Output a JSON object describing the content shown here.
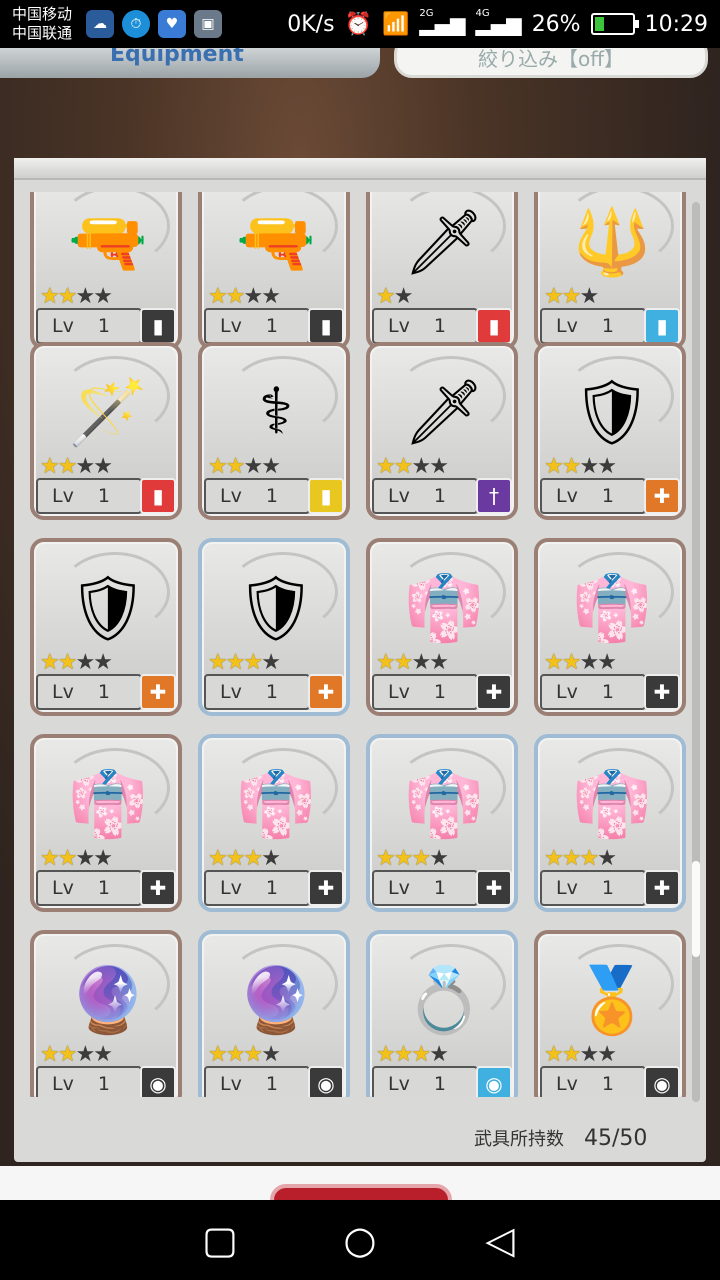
{
  "statusbar": {
    "carrier1": "中国移动",
    "carrier2": "中国联通",
    "net_speed": "0K/s",
    "net2g": "2G",
    "net4g": "4G",
    "battery": "26%",
    "time": "10:29",
    "battery_level": 0.26
  },
  "header": {
    "title": "Equipment",
    "filter_label": "絞り込み【off】"
  },
  "items": [
    {
      "icon": "rifle-icon",
      "emoji": "🔫",
      "stars": 2,
      "max": 4,
      "lv": "Lv",
      "level": "1",
      "type": "bullet",
      "type_color": "#3a3a3a",
      "frame": "brown"
    },
    {
      "icon": "rifle-icon",
      "emoji": "🔫",
      "stars": 2,
      "max": 4,
      "lv": "Lv",
      "level": "1",
      "type": "bullet",
      "type_color": "#3a3a3a",
      "frame": "brown"
    },
    {
      "icon": "spear-icon",
      "emoji": "🗡",
      "stars": 1,
      "max": 2,
      "lv": "Lv",
      "level": "1",
      "type": "fire",
      "type_color": "#e03a3a",
      "frame": "brown"
    },
    {
      "icon": "ice-staff-icon",
      "emoji": "🔱",
      "stars": 2,
      "max": 3,
      "lv": "Lv",
      "level": "1",
      "type": "water",
      "type_color": "#40b0e0",
      "frame": "brown"
    },
    {
      "icon": "staff-icon",
      "emoji": "🪄",
      "stars": 2,
      "max": 4,
      "lv": "Lv",
      "level": "1",
      "type": "fire",
      "type_color": "#e03a3a",
      "frame": "brown"
    },
    {
      "icon": "scepter-icon",
      "emoji": "⚕",
      "stars": 2,
      "max": 4,
      "lv": "Lv",
      "level": "1",
      "type": "light",
      "type_color": "#e8c820",
      "frame": "brown"
    },
    {
      "icon": "glaive-icon",
      "emoji": "🗡",
      "stars": 2,
      "max": 4,
      "lv": "Lv",
      "level": "1",
      "type": "dark",
      "type_color": "#6a3aa0",
      "frame": "brown"
    },
    {
      "icon": "gold-armor-icon",
      "emoji": "🛡",
      "stars": 2,
      "max": 4,
      "lv": "Lv",
      "level": "1",
      "type": "armor",
      "type_color": "#e07828",
      "frame": "brown"
    },
    {
      "icon": "gold-armor-icon",
      "emoji": "🛡",
      "stars": 2,
      "max": 4,
      "lv": "Lv",
      "level": "1",
      "type": "armor",
      "type_color": "#e07828",
      "frame": "brown"
    },
    {
      "icon": "gold-armor-icon",
      "emoji": "🛡",
      "stars": 3,
      "max": 4,
      "lv": "Lv",
      "level": "1",
      "type": "armor",
      "type_color": "#e07828",
      "frame": "blue"
    },
    {
      "icon": "white-coat-icon",
      "emoji": "👘",
      "stars": 2,
      "max": 4,
      "lv": "Lv",
      "level": "1",
      "type": "armor",
      "type_color": "#3a3a3a",
      "frame": "brown"
    },
    {
      "icon": "white-coat-icon",
      "emoji": "👘",
      "stars": 2,
      "max": 4,
      "lv": "Lv",
      "level": "1",
      "type": "armor",
      "type_color": "#3a3a3a",
      "frame": "brown"
    },
    {
      "icon": "white-coat-icon",
      "emoji": "👘",
      "stars": 2,
      "max": 4,
      "lv": "Lv",
      "level": "1",
      "type": "armor",
      "type_color": "#3a3a3a",
      "frame": "brown"
    },
    {
      "icon": "white-coat-icon",
      "emoji": "👘",
      "stars": 3,
      "max": 4,
      "lv": "Lv",
      "level": "1",
      "type": "armor",
      "type_color": "#3a3a3a",
      "frame": "blue"
    },
    {
      "icon": "white-coat-icon",
      "emoji": "👘",
      "stars": 3,
      "max": 4,
      "lv": "Lv",
      "level": "1",
      "type": "armor",
      "type_color": "#3a3a3a",
      "frame": "blue"
    },
    {
      "icon": "white-coat-icon",
      "emoji": "👘",
      "stars": 3,
      "max": 4,
      "lv": "Lv",
      "level": "1",
      "type": "armor",
      "type_color": "#3a3a3a",
      "frame": "blue"
    },
    {
      "icon": "pearl-earring-icon",
      "emoji": "🔮",
      "stars": 2,
      "max": 4,
      "lv": "Lv",
      "level": "1",
      "type": "accessory",
      "type_color": "#3a3a3a",
      "frame": "brown"
    },
    {
      "icon": "pearl-earring-icon",
      "emoji": "🔮",
      "stars": 3,
      "max": 4,
      "lv": "Lv",
      "level": "1",
      "type": "accessory",
      "type_color": "#3a3a3a",
      "frame": "blue"
    },
    {
      "icon": "rose-ring-icon",
      "emoji": "💍",
      "stars": 3,
      "max": 4,
      "lv": "Lv",
      "level": "1",
      "type": "accessory",
      "type_color": "#40b0e0",
      "frame": "blue"
    },
    {
      "icon": "gold-medal-icon",
      "emoji": "🏅",
      "stars": 2,
      "max": 4,
      "lv": "Lv",
      "level": "1",
      "type": "accessory",
      "type_color": "#3a3a3a",
      "frame": "brown"
    }
  ],
  "footer": {
    "count_label": "武具所持数",
    "count_value": "45/50"
  },
  "scroll": {
    "position": 0.82
  }
}
